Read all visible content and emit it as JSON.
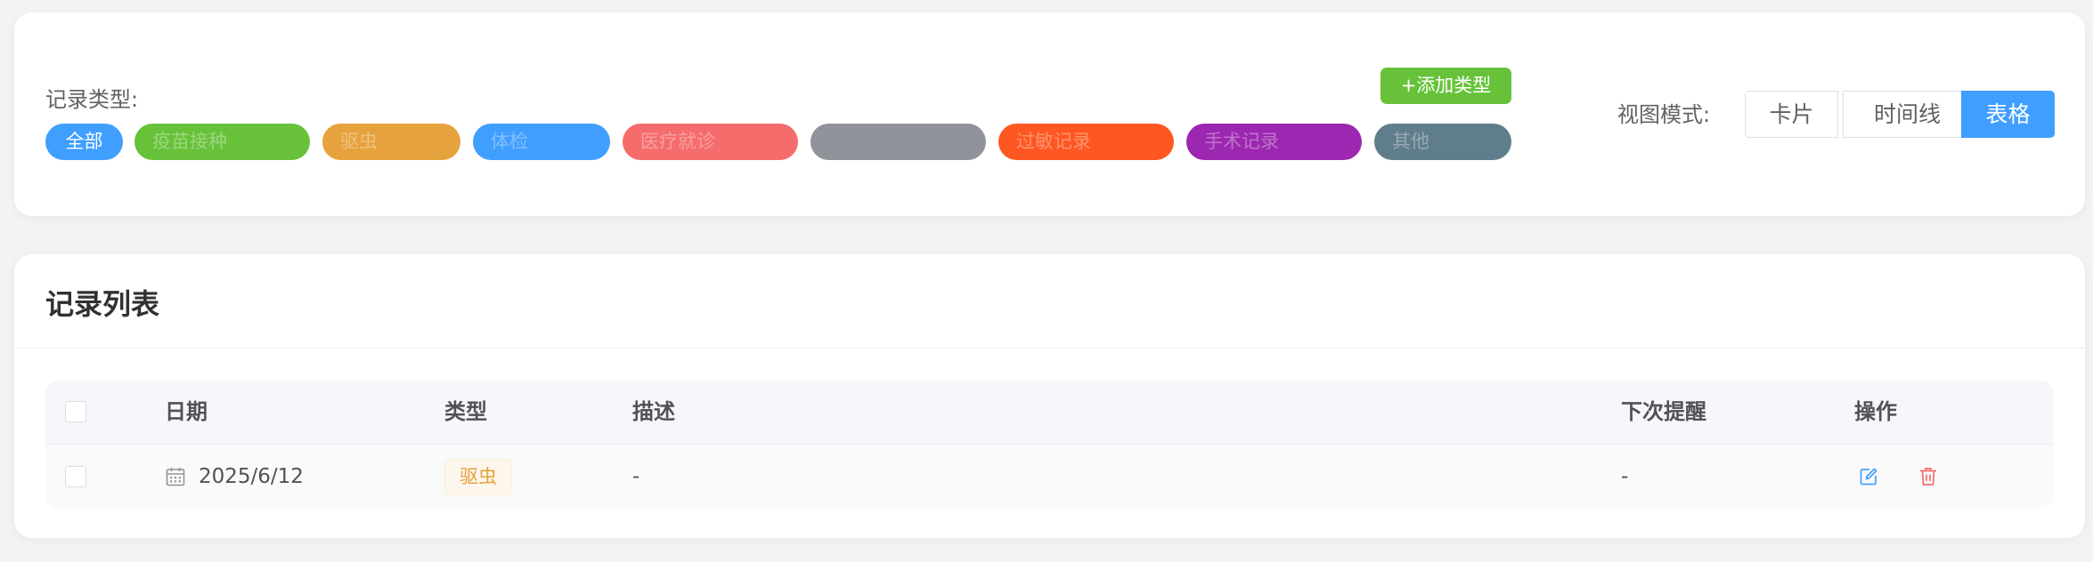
{
  "filter": {
    "label": "记录类型:",
    "add_type_label": "+添加类型",
    "chips": [
      {
        "label": "全部",
        "color": "#409eff",
        "active": true
      },
      {
        "label": "疫苗接种",
        "color": "#67c23a",
        "active": false
      },
      {
        "label": "驱虫",
        "color": "#e6a23c",
        "active": false
      },
      {
        "label": "体检",
        "color": "#409eff",
        "active": false
      },
      {
        "label": "医疗就诊",
        "color": "#f56c6c",
        "active": false
      },
      {
        "label": "",
        "color": "#909399",
        "active": false
      },
      {
        "label": "过敏记录",
        "color": "#ff5722",
        "active": false
      },
      {
        "label": "手术记录",
        "color": "#9c27b0",
        "active": false
      },
      {
        "label": "其他",
        "color": "#607d8b",
        "active": false
      }
    ]
  },
  "view_mode": {
    "label": "视图模式:",
    "options": [
      "卡片",
      "时间线",
      "表格"
    ],
    "selected": "表格"
  },
  "list": {
    "title": "记录列表",
    "columns": {
      "date": "日期",
      "type": "类型",
      "desc": "描述",
      "next_reminder": "下次提醒",
      "actions": "操作"
    },
    "rows": [
      {
        "date": "2025/6/12",
        "type": "驱虫",
        "desc": "-",
        "next_reminder": "-"
      }
    ]
  },
  "colors": {
    "primary": "#409eff",
    "success": "#67c23a",
    "warning": "#e6a23c",
    "danger": "#f56c6c"
  },
  "icons": {
    "date": "calendar-icon",
    "edit": "edit-icon",
    "delete": "trash-icon"
  }
}
